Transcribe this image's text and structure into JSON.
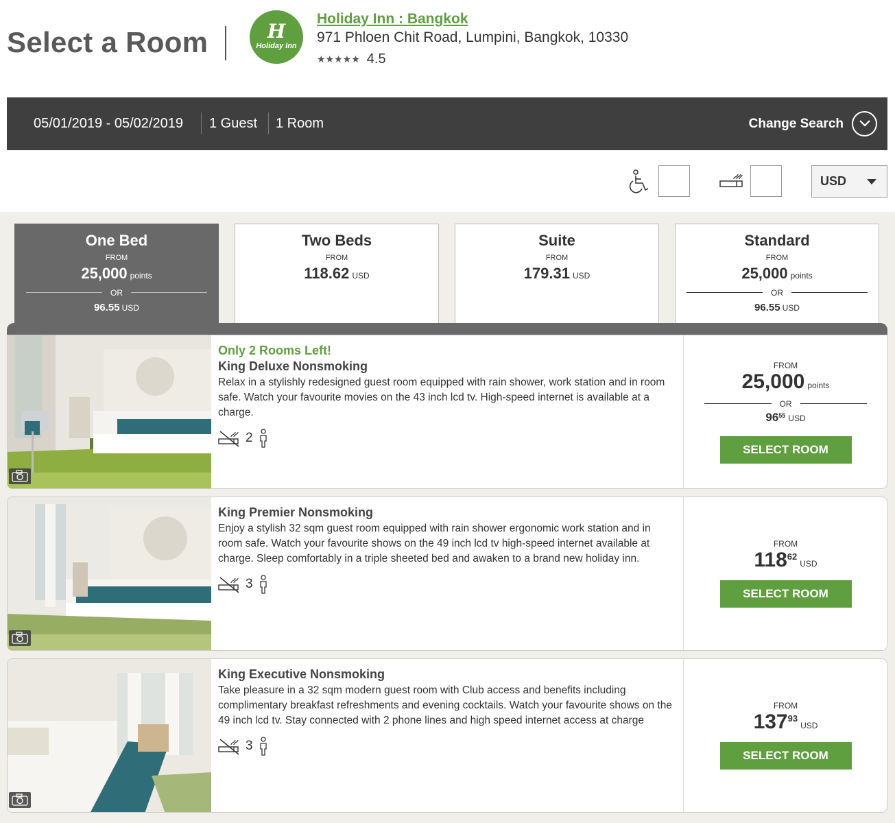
{
  "header": {
    "page_title": "Select a Room",
    "logo_mark": "H",
    "logo_text": "Holiday Inn",
    "hotel_name": "Holiday Inn : Bangkok",
    "hotel_address": "971 Phloen Chit Road, Lumpini, Bangkok, 10330",
    "stars": "★★★★★",
    "rating": "4.5"
  },
  "search": {
    "dates": "05/01/2019 - 05/02/2019",
    "guests": "1 Guest",
    "rooms": "1 Room",
    "change_label": "Change Search",
    "change_icon": "chevron-down-icon"
  },
  "filters": {
    "accessible_icon": "wheelchair-icon",
    "smoking_icon": "smoking-icon",
    "currency": "USD"
  },
  "tabs": [
    {
      "name": "One Bed",
      "from": "FROM",
      "price": "25,000",
      "unit": "points",
      "or": "OR",
      "usd": "96.55",
      "usd_unit": "USD",
      "active": true
    },
    {
      "name": "Two Beds",
      "from": "FROM",
      "price": "118.62",
      "unit": "USD",
      "active": false
    },
    {
      "name": "Suite",
      "from": "FROM",
      "price": "179.31",
      "unit": "USD",
      "active": false
    },
    {
      "name": "Standard",
      "from": "FROM",
      "price": "25,000",
      "unit": "points",
      "or": "OR",
      "usd": "96.55",
      "usd_unit": "USD",
      "active": false
    }
  ],
  "rooms": [
    {
      "urgency": "Only 2 Rooms Left!",
      "name": "King Deluxe Nonsmoking",
      "description": "Relax in a stylishly redesigned guest room equipped with rain shower, work station and in room safe. Watch your favourite movies on the 43 inch lcd tv. High-speed internet is available at a charge.",
      "occupancy": "2",
      "from": "FROM",
      "price": "25,000",
      "price_unit": "points",
      "or": "OR",
      "usd_whole": "96",
      "usd_cents": "55",
      "usd_unit": "USD",
      "button": "SELECT ROOM"
    },
    {
      "name": "King Premier Nonsmoking",
      "description": "Enjoy a stylish 32 sqm guest room equipped with rain shower ergonomic work station and in room safe. Watch your favourite shows on the 49 inch lcd tv high-speed internet available at charge. Sleep comfortably in a triple sheeted bed and awaken to a brand new holiday inn.",
      "occupancy": "3",
      "from": "FROM",
      "price_whole": "118",
      "price_cents": "62",
      "price_unit": "USD",
      "button": "SELECT ROOM"
    },
    {
      "name": "King Executive Nonsmoking",
      "description": "Take pleasure in a 32 sqm modern guest room with Club access and benefits including complimentary breakfast refreshments and evening cocktails. Watch your favourite shows on the 49 inch lcd tv. Stay connected with 2 phone lines and high speed internet access at charge",
      "occupancy": "3",
      "from": "FROM",
      "price_whole": "137",
      "price_cents": "93",
      "price_unit": "USD",
      "button": "SELECT ROOM"
    }
  ],
  "colors": {
    "brand_green": "#5f9f3f",
    "search_bar": "#3f3f3f",
    "active_tab": "#696969",
    "content_bg": "#f0efe9"
  }
}
